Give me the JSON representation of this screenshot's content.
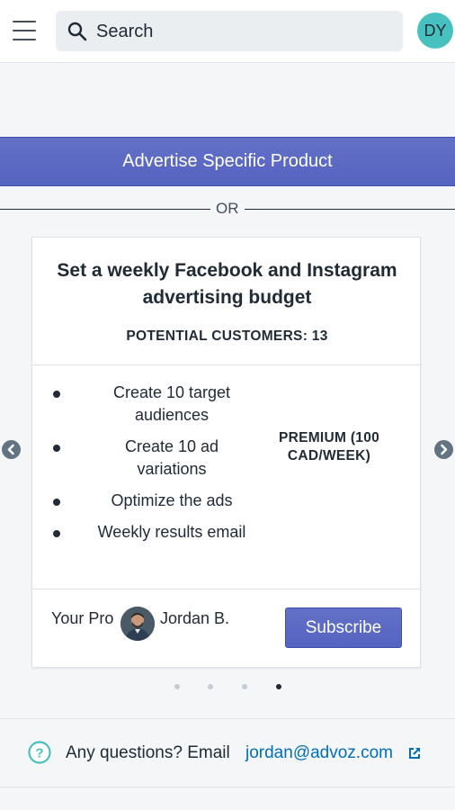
{
  "header": {
    "search_placeholder": "Search",
    "avatar_initials": "DY"
  },
  "actions": {
    "advertise_product_label": "Advertise Specific Product",
    "or_label": "OR"
  },
  "plan_card": {
    "title": "Set a weekly Facebook and Instagram advertising budget",
    "potential_customers": "POTENTIAL CUSTOMERS: 13",
    "features": [
      "Create 10 target audiences",
      "Create 10 ad variations",
      "Optimize the ads",
      "Weekly results email"
    ],
    "plan_name": "PREMIUM (100 CAD/WEEK)",
    "pro_label": "Your Pro",
    "pro_name": "Jordan B.",
    "subscribe_label": "Subscribe"
  },
  "carousel": {
    "slide_count": 4,
    "active_slide": 4
  },
  "help": {
    "text": "Any questions? Email",
    "email": "jordan@advoz.com"
  },
  "colors": {
    "primary": "#5c6ac4",
    "accent_teal": "#47c1bf",
    "link": "#006fbb",
    "background": "#f4f6f8"
  }
}
